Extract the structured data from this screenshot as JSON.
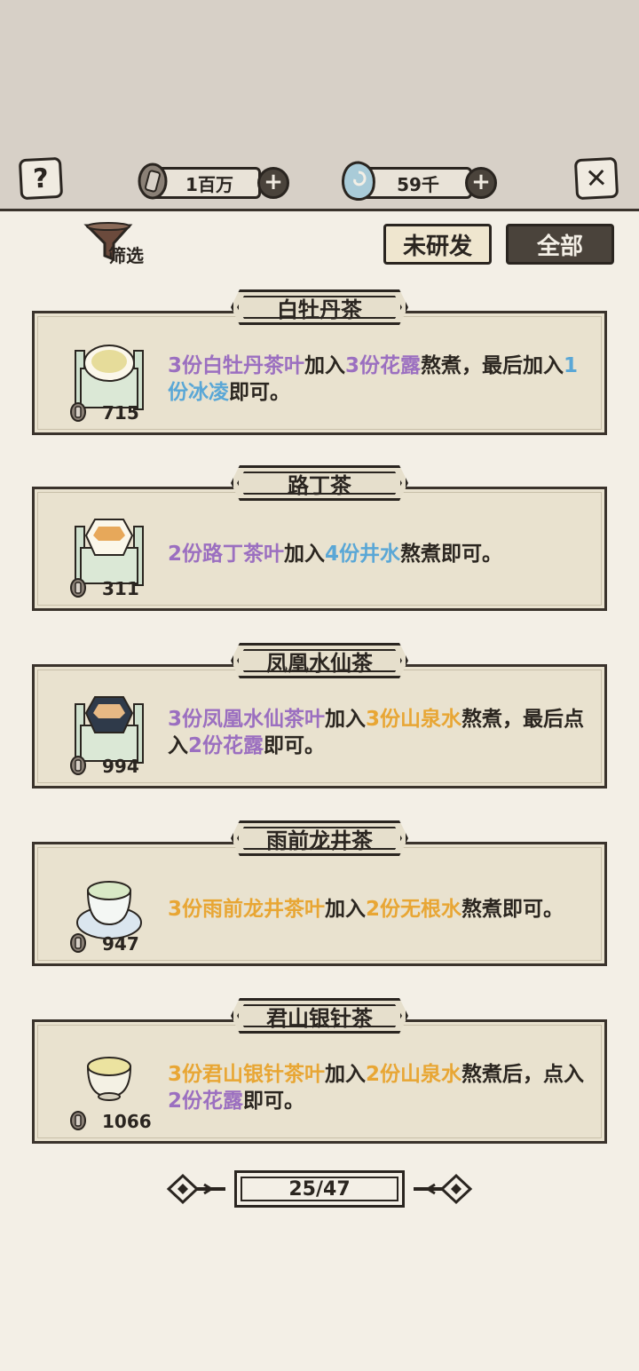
{
  "header": {
    "help_icon_glyph": "?",
    "close_icon_glyph": "✕",
    "coins_value": "1百万",
    "jade_value": "59千",
    "plus_glyph": "+"
  },
  "toolbar": {
    "filter_label": "筛选",
    "tab_undeveloped": "未研发",
    "tab_all": "全部"
  },
  "recipes": [
    {
      "title": "白牡丹茶",
      "price": "715",
      "icon": "tea-bowl-on-mat-icon",
      "parts": [
        {
          "t": "3份白牡丹茶叶",
          "c": "purple"
        },
        {
          "t": "加入",
          "c": "dark"
        },
        {
          "t": "3份花露",
          "c": "purple"
        },
        {
          "t": "熬煮，最后加入",
          "c": "dark"
        },
        {
          "t": "1份冰凌",
          "c": "blue"
        },
        {
          "t": "即可。",
          "c": "dark"
        }
      ]
    },
    {
      "title": "路丁茶",
      "price": "311",
      "icon": "hexagon-cup-on-mat-icon",
      "parts": [
        {
          "t": "2份路丁茶叶",
          "c": "purple"
        },
        {
          "t": "加入",
          "c": "dark"
        },
        {
          "t": "4份井水",
          "c": "blue"
        },
        {
          "t": "熬煮即可。",
          "c": "dark"
        }
      ]
    },
    {
      "title": "凤凰水仙茶",
      "price": "994",
      "icon": "dark-hexagon-cup-on-mat-icon",
      "parts": [
        {
          "t": "3份凤凰水仙茶叶",
          "c": "purple"
        },
        {
          "t": "加入",
          "c": "dark"
        },
        {
          "t": "3份山泉水",
          "c": "orange"
        },
        {
          "t": "熬煮，最后点入",
          "c": "dark"
        },
        {
          "t": "2份花露",
          "c": "purple"
        },
        {
          "t": "即可。",
          "c": "dark"
        }
      ]
    },
    {
      "title": "雨前龙井茶",
      "price": "947",
      "icon": "tea-cup-on-saucer-icon",
      "parts": [
        {
          "t": "3份雨前龙井茶叶",
          "c": "orange"
        },
        {
          "t": "加入",
          "c": "dark"
        },
        {
          "t": "2份无根水",
          "c": "orange"
        },
        {
          "t": "熬煮即可。",
          "c": "dark"
        }
      ]
    },
    {
      "title": "君山银针茶",
      "price": "1066",
      "icon": "small-tea-bowl-icon",
      "parts": [
        {
          "t": "3份君山银针茶叶",
          "c": "orange"
        },
        {
          "t": "加入",
          "c": "dark"
        },
        {
          "t": "2份山泉水",
          "c": "orange"
        },
        {
          "t": "熬煮后，点入",
          "c": "dark"
        },
        {
          "t": "2份花露",
          "c": "purple"
        },
        {
          "t": "即可。",
          "c": "dark"
        }
      ]
    }
  ],
  "pager": {
    "label": "25/47"
  },
  "colors": {
    "background": "#f3efe6",
    "top_band": "#d7d0c7",
    "card": "#e9e2cf",
    "ink": "#2a2520",
    "purple": "#9b6fc0",
    "blue": "#5aa7d6",
    "orange": "#e8a634",
    "tab_all_bg": "#4a433b"
  }
}
